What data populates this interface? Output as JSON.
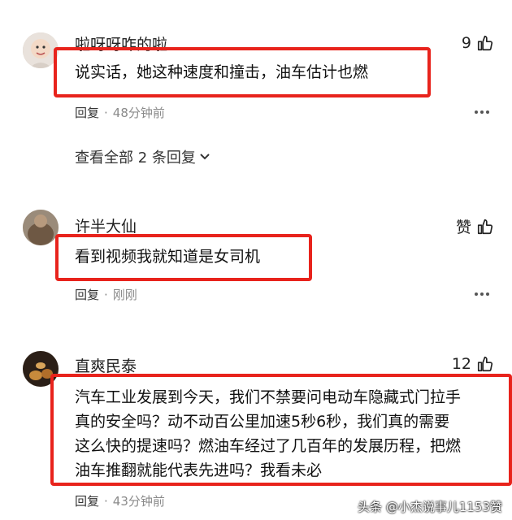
{
  "comments": [
    {
      "username": "啦呀呀咋的啦",
      "likes": "9",
      "text": "说实话，她这种速度和撞击，油车估计也燃",
      "reply_label": "回复",
      "dot": "·",
      "time": "48分钟前",
      "view_all": "查看全部 2 条回复"
    },
    {
      "username": "许半大仙",
      "likes": "赞",
      "text": "看到视频我就知道是女司机",
      "reply_label": "回复",
      "dot": "·",
      "time": "刚刚"
    },
    {
      "username": "直爽民泰",
      "likes": "12",
      "text_lines": [
        "汽车工业发展到今天，我们不禁要问电动车隐藏式门拉手",
        "真的安全吗？动不动百公里加速5秒6秒，我们真的需要",
        "这么快的提速吗？燃油车经过了几百年的发展历程，把燃",
        "油车推翻就能代表先进吗？我看未必"
      ],
      "reply_label": "回复",
      "dot": "·",
      "time": "43分钟前"
    }
  ],
  "watermark": "头条 @小杰说事儿1153赞",
  "colors": {
    "highlight_border": "#e8231c",
    "meta_gray": "#8a8a8a"
  }
}
